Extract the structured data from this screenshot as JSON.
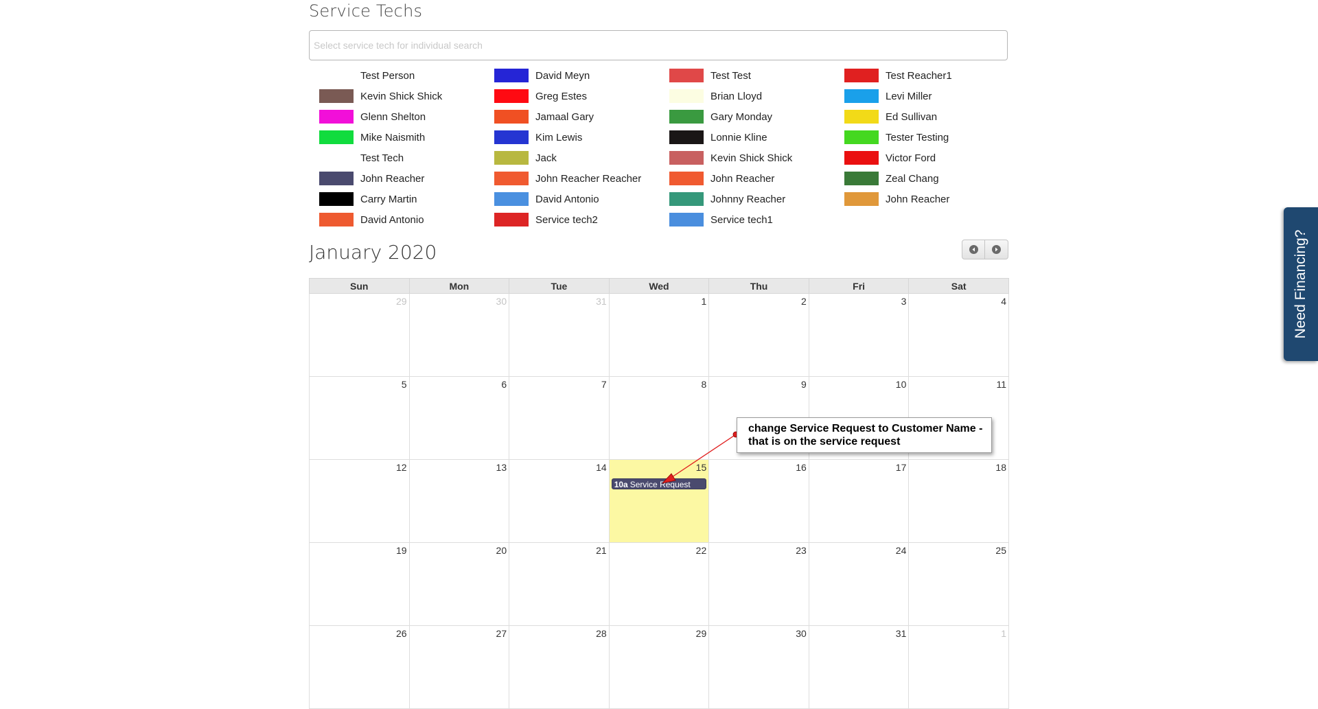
{
  "techs_section": {
    "title": "Service Techs",
    "search_placeholder": "Select service tech for individual search"
  },
  "techs": [
    {
      "name": "Test Person",
      "color": "#ffffff"
    },
    {
      "name": "Kevin Shick Shick",
      "color": "#7a5a54"
    },
    {
      "name": "Glenn Shelton",
      "color": "#f20fd9"
    },
    {
      "name": "Mike Naismith",
      "color": "#11dc3e"
    },
    {
      "name": "Test Tech",
      "color": "#ffffff"
    },
    {
      "name": "John Reacher",
      "color": "#4a4a6e"
    },
    {
      "name": "Carry Martin",
      "color": "#000000"
    },
    {
      "name": "David Antonio",
      "color": "#ee5a30"
    },
    {
      "name": "David Meyn",
      "color": "#2525d6"
    },
    {
      "name": "Greg Estes",
      "color": "#ff0a12"
    },
    {
      "name": "Jamaal Gary",
      "color": "#f05023"
    },
    {
      "name": "Kim Lewis",
      "color": "#2535d2"
    },
    {
      "name": "Jack",
      "color": "#b8b840"
    },
    {
      "name": "John Reacher Reacher",
      "color": "#f05a30"
    },
    {
      "name": "David Antonio",
      "color": "#4a90e0"
    },
    {
      "name": "Service tech2",
      "color": "#dd2525"
    },
    {
      "name": "Test Test",
      "color": "#e04848"
    },
    {
      "name": "Brian Lloyd",
      "color": "#fcfde2"
    },
    {
      "name": "Gary Monday",
      "color": "#3a9a40"
    },
    {
      "name": "Lonnie Kline",
      "color": "#1a1616"
    },
    {
      "name": "Kevin Shick Shick",
      "color": "#c86060"
    },
    {
      "name": "John Reacher",
      "color": "#f05a30"
    },
    {
      "name": "Johnny Reacher",
      "color": "#35987a"
    },
    {
      "name": "Service tech1",
      "color": "#4a8ede"
    },
    {
      "name": "Test Reacher1",
      "color": "#e02020"
    },
    {
      "name": "Levi Miller",
      "color": "#1aa0ea"
    },
    {
      "name": "Ed Sullivan",
      "color": "#f2da18"
    },
    {
      "name": "Tester Testing",
      "color": "#44d820"
    },
    {
      "name": "Victor Ford",
      "color": "#ea1010"
    },
    {
      "name": "Zeal Chang",
      "color": "#3a7a38"
    },
    {
      "name": "John Reacher",
      "color": "#e0983a"
    }
  ],
  "calendar": {
    "month_title": "January 2020",
    "weekdays": [
      "Sun",
      "Mon",
      "Tue",
      "Wed",
      "Thu",
      "Fri",
      "Sat"
    ],
    "weeks": [
      [
        "29",
        "30",
        "31",
        "1",
        "2",
        "3",
        "4"
      ],
      [
        "5",
        "6",
        "7",
        "8",
        "9",
        "10",
        "11"
      ],
      [
        "12",
        "13",
        "14",
        "15",
        "16",
        "17",
        "18"
      ],
      [
        "19",
        "20",
        "21",
        "22",
        "23",
        "24",
        "25"
      ],
      [
        "26",
        "27",
        "28",
        "29",
        "30",
        "31",
        "1"
      ]
    ],
    "event": {
      "time": "10a",
      "title": "Service Request",
      "color": "#4a4a6e"
    },
    "today_color": "#fcf8a3"
  },
  "annotation": {
    "text": "change Service Request to Customer Name - that is on the service request"
  },
  "financing_tab": {
    "label": "Need Financing?"
  }
}
